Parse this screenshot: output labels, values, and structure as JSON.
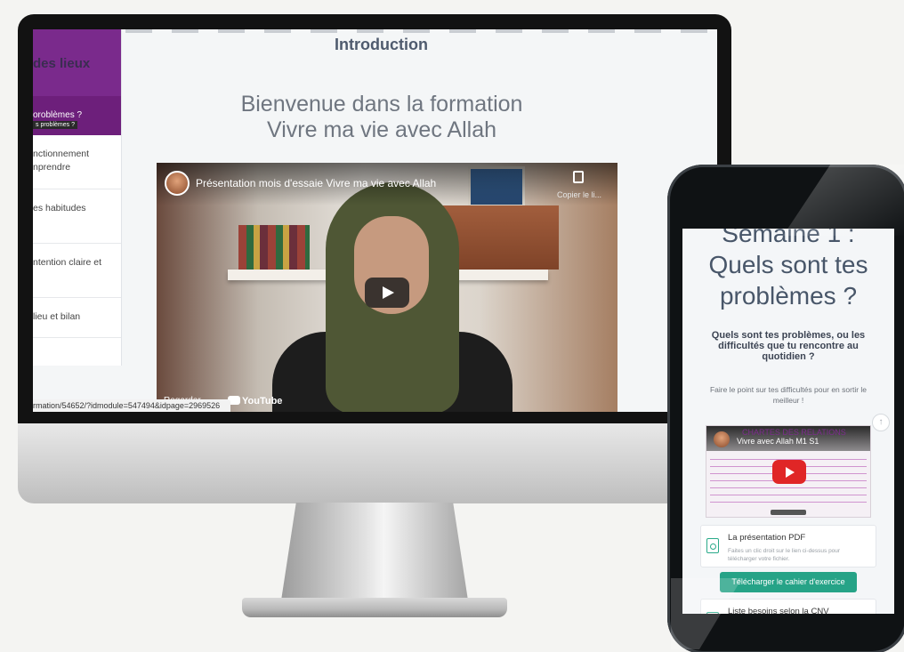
{
  "desktop": {
    "sidebar": {
      "header": "des lieux",
      "active_item": "oroblèmes ?",
      "active_tooltip": "s problèmes ?",
      "items": [
        {
          "line1": "nctionnement",
          "line2": "nprendre"
        },
        {
          "line1": "es habitudes",
          "line2": ""
        },
        {
          "line1": "ntention claire et",
          "line2": ""
        },
        {
          "line1": "lieu et bilan",
          "line2": ""
        }
      ]
    },
    "page_title": "Introduction",
    "welcome_line1": "Bienvenue dans la formation",
    "welcome_line2": "Vivre ma vie avec Allah",
    "video": {
      "title": "Présentation mois d'essaie Vivre ma vie avec Allah",
      "copy_label": "Copier le li...",
      "watch_on": "Regarder",
      "brand": "YouTube"
    },
    "status_url": "rmation/54652/?idmodule=547494&idpage=2969526"
  },
  "mobile": {
    "heading_line1": "Semaine 1 :",
    "heading_line2": "Quels sont tes",
    "heading_line3": "problèmes ?",
    "subheading": "Quels sont tes problèmes, ou les difficultés que tu rencontre au quotidien ?",
    "body": "Faire le point sur tes difficultés pour en sortir le meilleur !",
    "scroll_up_icon": "↑",
    "video": {
      "tag": "CHARTES DES RELATIONS",
      "title": "Vivre avec Allah M1 S1"
    },
    "card1": {
      "title": "La présentation PDF",
      "desc": "Faites un clic droit sur le lien ci-dessus pour télécharger votre fichier."
    },
    "download_button": "Télécharger le cahier d'exercice",
    "card2": {
      "title": "Liste besoins selon la CNV"
    }
  },
  "colors": {
    "sidebar_purple": "#6d1f7b",
    "accent_green": "#26a387",
    "youtube_red": "#e02626"
  }
}
